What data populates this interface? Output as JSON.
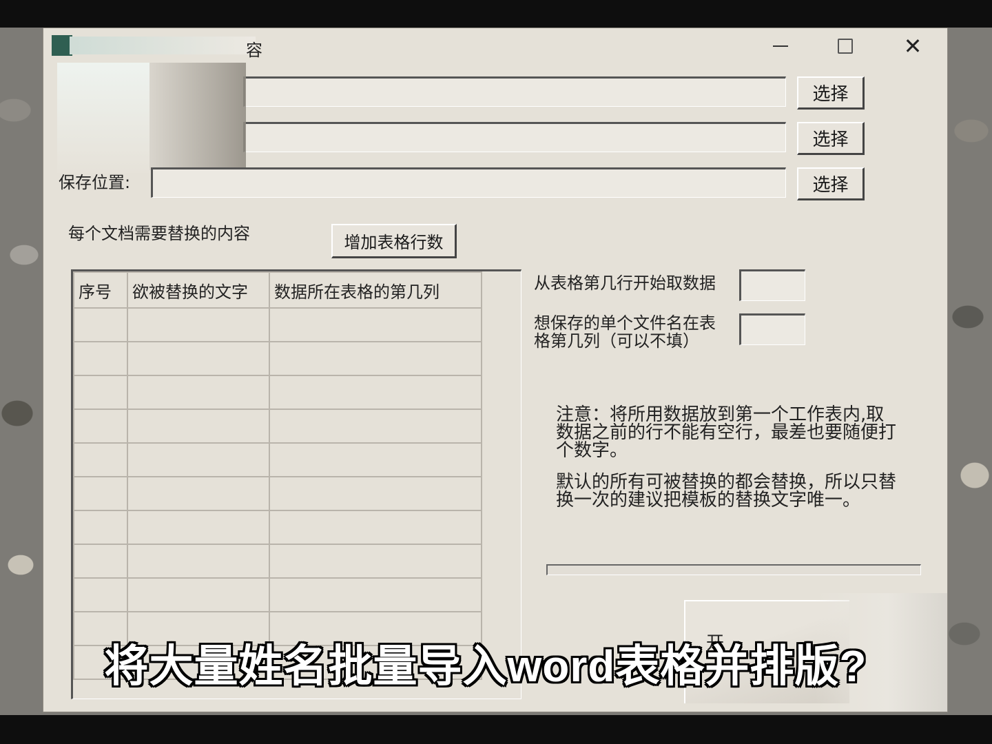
{
  "window": {
    "title": "容",
    "controls": {
      "minimize": "—",
      "maximize": "☐",
      "close": "✕"
    }
  },
  "file_rows": [
    {
      "label": "",
      "value": "",
      "button": "选择"
    },
    {
      "label": "",
      "value": "",
      "button": "选择"
    },
    {
      "label": "保存位置:",
      "value": "",
      "button": "选择"
    }
  ],
  "replace_section": {
    "label": "每个文档需要替换的内容",
    "add_rows_button": "增加表格行数",
    "table": {
      "columns": [
        "序号",
        "欲被替换的文字",
        "数据所在表格的第几列"
      ],
      "rows": [
        [
          "",
          "",
          ""
        ],
        [
          "",
          "",
          ""
        ],
        [
          "",
          "",
          ""
        ],
        [
          "",
          "",
          ""
        ],
        [
          "",
          "",
          ""
        ],
        [
          "",
          "",
          ""
        ],
        [
          "",
          "",
          ""
        ],
        [
          "",
          "",
          ""
        ],
        [
          "",
          "",
          ""
        ],
        [
          "",
          "",
          ""
        ],
        [
          "",
          "",
          ""
        ]
      ]
    }
  },
  "settings": {
    "start_row_label": "从表格第几行开始取数据",
    "start_row_value": "",
    "filename_col_label_line1": "想保存的单个文件名在表",
    "filename_col_label_line2": "格第几列（可以不填）",
    "filename_col_value": ""
  },
  "notes": {
    "note1_line1": "注意：将所用数据放到第一个工作表内,取",
    "note1_line2": "数据之前的行不能有空行，最差也要随便打",
    "note1_line3": "个数字。",
    "note2_line1": "默认的所有可被替换的都会替换，所以只替",
    "note2_line2": "换一次的建议把模板的替换文字唯一。"
  },
  "progress": {
    "value": 0
  },
  "start_button": "开",
  "subtitle": "将大量姓名批量导入word表格并排版?"
}
